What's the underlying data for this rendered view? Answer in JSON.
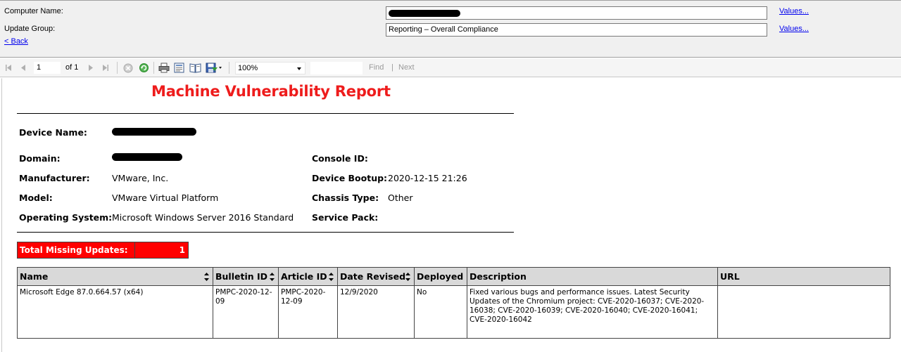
{
  "params": {
    "computer_name_label": "Computer Name:",
    "computer_name_value": "",
    "update_group_label": "Update Group:",
    "update_group_value": "Reporting – Overall Compliance",
    "values_link_1": "Values...",
    "values_link_2": "Values...",
    "back_link": "< Back"
  },
  "toolbar": {
    "page_current": "1",
    "page_of": "of 1",
    "zoom": "100%",
    "find": "Find",
    "separator": "|",
    "next": "Next",
    "icons": [
      "first-page-icon",
      "previous-page-icon",
      "next-page-icon",
      "last-page-icon",
      "stop-icon",
      "refresh-icon",
      "print-icon",
      "print-layout-icon",
      "page-setup-icon",
      "export-icon"
    ]
  },
  "report": {
    "title": "Machine Vulnerability Report",
    "fields": {
      "device_name_label": "Device Name:",
      "domain_label": "Domain:",
      "manufacturer_label": "Manufacturer:",
      "manufacturer_value": "VMware, Inc.",
      "model_label": "Model:",
      "model_value": "VMware Virtual Platform",
      "os_label": "Operating System:",
      "os_value": "Microsoft Windows Server 2016 Standard",
      "console_id_label": "Console ID:",
      "device_bootup_label": "Device Bootup:",
      "device_bootup_value": "2020-12-15 21:26",
      "chassis_type_label": "Chassis Type:",
      "chassis_type_value": "Other",
      "service_pack_label": "Service Pack:"
    },
    "missing": {
      "label": "Total Missing Updates:",
      "count": "1"
    },
    "table": {
      "headers": [
        "Name",
        "Bulletin ID",
        "Article ID",
        "Date Revised",
        "Deployed",
        "Description",
        "URL"
      ],
      "rows": [
        {
          "name": "Microsoft Edge 87.0.664.57 (x64)",
          "bulletin_id": "PMPC-2020-12-09",
          "article_id": "PMPC-2020-12-09",
          "date_revised": "12/9/2020",
          "deployed": "No",
          "description": "Fixed various bugs and performance issues. Latest Security Updates of the Chromium project: CVE-2020-16037; CVE-2020-16038; CVE-2020-16039; CVE-2020-16040; CVE-2020-16041; CVE-2020-16042",
          "url": ""
        }
      ]
    }
  },
  "colors": {
    "title": "#ee1c1c",
    "missing_bg": "#ff0000",
    "link": "#0000ee",
    "header_bg": "#d9d9d9"
  }
}
